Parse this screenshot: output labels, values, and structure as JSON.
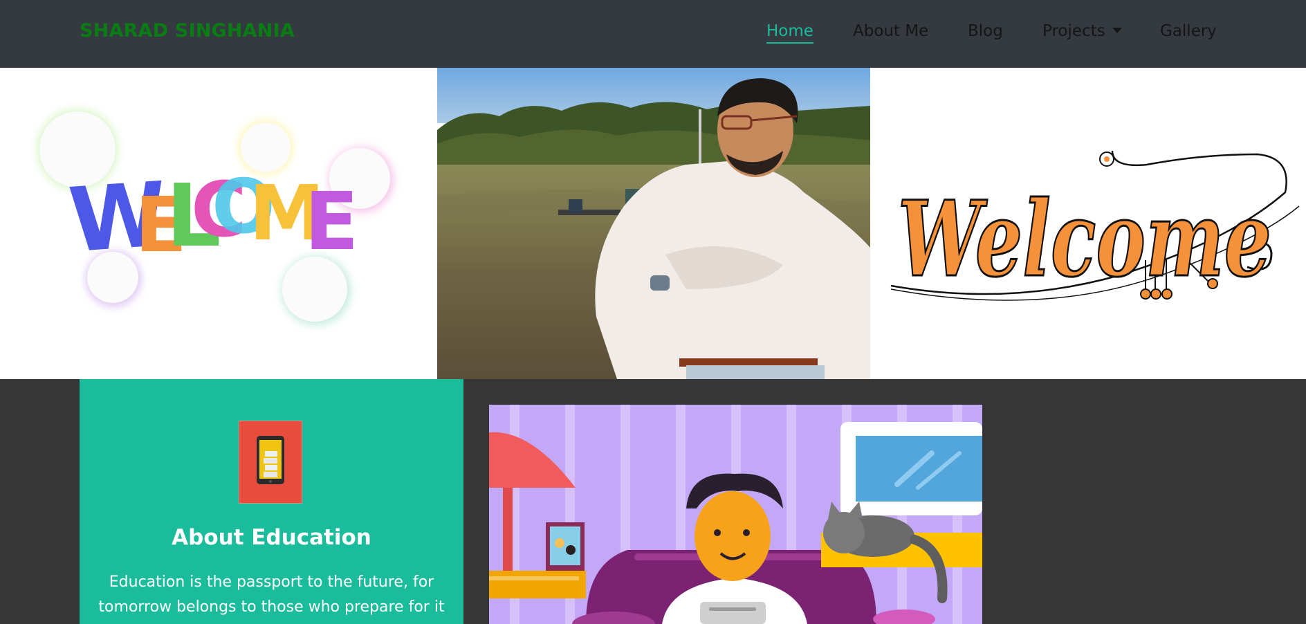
{
  "navbar": {
    "brand": "SHARAD SINGHANIA",
    "items": [
      {
        "label": "Home",
        "active": true
      },
      {
        "label": "About Me"
      },
      {
        "label": "Blog"
      },
      {
        "label": "Projects",
        "dropdown": true
      },
      {
        "label": "Gallery"
      }
    ]
  },
  "hero": {
    "left_word": [
      "W",
      "E",
      "L",
      "C",
      "O",
      "M",
      "E"
    ],
    "right_word": "Welcome"
  },
  "education": {
    "title": "About Education",
    "text_line1": "Education is the passport to the future, for",
    "text_line2": "tomorrow belongs to those who prepare for it"
  },
  "colors": {
    "nav_bg": "#343a40",
    "brand": "#0a7c14",
    "accent": "#1bbc9b",
    "dark_bg": "#363636"
  }
}
